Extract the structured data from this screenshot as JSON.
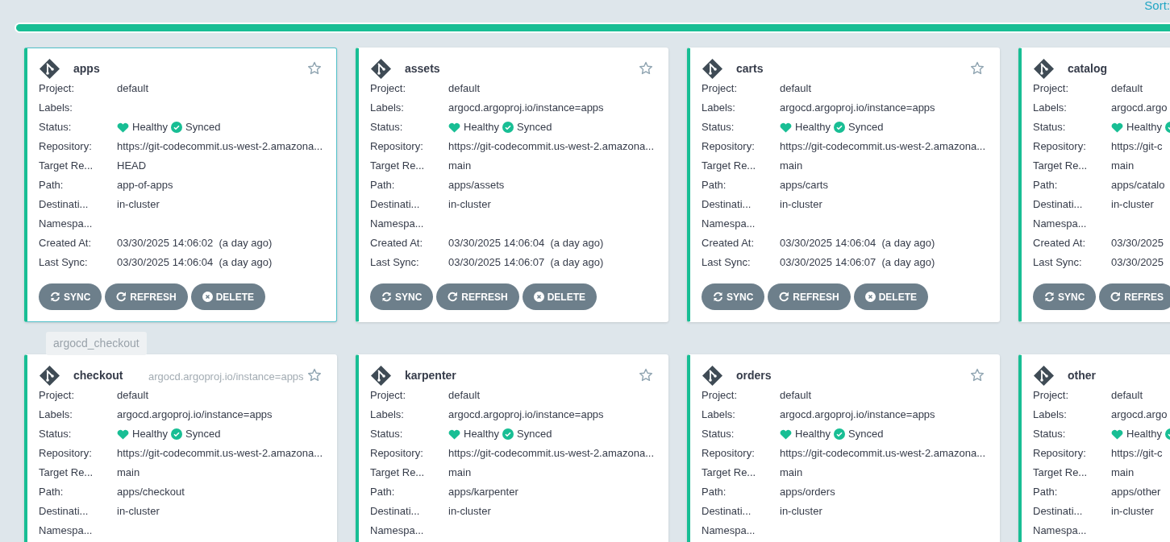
{
  "sort": {
    "label": "Sort:"
  },
  "apps": [
    {
      "name": "apps",
      "selected": true,
      "fields": [
        {
          "kind": "text",
          "label": "Project:",
          "value": "default"
        },
        {
          "kind": "text",
          "label": "Labels:"
        },
        {
          "kind": "status",
          "label": "Status:",
          "healthy": true,
          "health": "Healthy",
          "synced": true,
          "sync": "Synced"
        },
        {
          "kind": "text",
          "label": "Repository:",
          "value": "https://git-codecommit.us-west-2.amazona..."
        },
        {
          "kind": "text",
          "label": "Target Re...",
          "value": "HEAD"
        },
        {
          "kind": "text",
          "label": "Path:",
          "value": "app-of-apps"
        },
        {
          "kind": "text",
          "label": "Destinati...",
          "value": "in-cluster"
        },
        {
          "kind": "text",
          "label": "Namespa..."
        },
        {
          "kind": "text",
          "label": "Created At:",
          "value": "03/30/2025 14:06:02  (a day ago)"
        },
        {
          "kind": "text",
          "label": "Last Sync:",
          "value": "03/30/2025 14:06:04  (a day ago)"
        }
      ],
      "buttons": [
        {
          "kind": "sync",
          "label": "SYNC"
        },
        {
          "kind": "refresh",
          "label": "REFRESH"
        },
        {
          "kind": "delete",
          "label": "DELETE"
        }
      ]
    },
    {
      "name": "assets",
      "selected": false,
      "fields": [
        {
          "kind": "text",
          "label": "Project:",
          "value": "default"
        },
        {
          "kind": "text",
          "label": "Labels:",
          "value": "argocd.argoproj.io/instance=apps"
        },
        {
          "kind": "status",
          "label": "Status:",
          "healthy": true,
          "health": "Healthy",
          "synced": true,
          "sync": "Synced"
        },
        {
          "kind": "text",
          "label": "Repository:",
          "value": "https://git-codecommit.us-west-2.amazona..."
        },
        {
          "kind": "text",
          "label": "Target Re...",
          "value": "main"
        },
        {
          "kind": "text",
          "label": "Path:",
          "value": "apps/assets"
        },
        {
          "kind": "text",
          "label": "Destinati...",
          "value": "in-cluster"
        },
        {
          "kind": "text",
          "label": "Namespa..."
        },
        {
          "kind": "text",
          "label": "Created At:",
          "value": "03/30/2025 14:06:04  (a day ago)"
        },
        {
          "kind": "text",
          "label": "Last Sync:",
          "value": "03/30/2025 14:06:07  (a day ago)"
        }
      ],
      "buttons": [
        {
          "kind": "sync",
          "label": "SYNC"
        },
        {
          "kind": "refresh",
          "label": "REFRESH"
        },
        {
          "kind": "delete",
          "label": "DELETE"
        }
      ]
    },
    {
      "name": "carts",
      "selected": false,
      "fields": [
        {
          "kind": "text",
          "label": "Project:",
          "value": "default"
        },
        {
          "kind": "text",
          "label": "Labels:",
          "value": "argocd.argoproj.io/instance=apps"
        },
        {
          "kind": "status",
          "label": "Status:",
          "healthy": true,
          "health": "Healthy",
          "synced": true,
          "sync": "Synced"
        },
        {
          "kind": "text",
          "label": "Repository:",
          "value": "https://git-codecommit.us-west-2.amazona..."
        },
        {
          "kind": "text",
          "label": "Target Re...",
          "value": "main"
        },
        {
          "kind": "text",
          "label": "Path:",
          "value": "apps/carts"
        },
        {
          "kind": "text",
          "label": "Destinati...",
          "value": "in-cluster"
        },
        {
          "kind": "text",
          "label": "Namespa..."
        },
        {
          "kind": "text",
          "label": "Created At:",
          "value": "03/30/2025 14:06:04  (a day ago)"
        },
        {
          "kind": "text",
          "label": "Last Sync:",
          "value": "03/30/2025 14:06:07  (a day ago)"
        }
      ],
      "buttons": [
        {
          "kind": "sync",
          "label": "SYNC"
        },
        {
          "kind": "refresh",
          "label": "REFRESH"
        },
        {
          "kind": "delete",
          "label": "DELETE"
        }
      ]
    },
    {
      "name": "catalog",
      "selected": false,
      "fields": [
        {
          "kind": "text",
          "label": "Project:",
          "value": "default"
        },
        {
          "kind": "text",
          "label": "Labels:",
          "value": "argocd.argo"
        },
        {
          "kind": "status",
          "label": "Status:",
          "healthy": true,
          "health": "Healthy",
          "synced": true
        },
        {
          "kind": "text",
          "label": "Repository:",
          "value": "https://git-c"
        },
        {
          "kind": "text",
          "label": "Target Re...",
          "value": "main"
        },
        {
          "kind": "text",
          "label": "Path:",
          "value": "apps/catalo"
        },
        {
          "kind": "text",
          "label": "Destinati...",
          "value": "in-cluster"
        },
        {
          "kind": "text",
          "label": "Namespa..."
        },
        {
          "kind": "text",
          "label": "Created At:",
          "value": "03/30/2025"
        },
        {
          "kind": "text",
          "label": "Last Sync:",
          "value": "03/30/2025"
        }
      ],
      "buttons": [
        {
          "kind": "sync",
          "label": "SYNC"
        },
        {
          "kind": "refresh",
          "label": "REFRES"
        }
      ]
    },
    {
      "name": "checkout",
      "selected": false,
      "title_tooltip": "argocd_checkout",
      "labels_tooltip": "argocd.argoproj.io/instance=apps",
      "fields": [
        {
          "kind": "text",
          "label": "Project:",
          "value": "default"
        },
        {
          "kind": "text",
          "label": "Labels:",
          "value": "argocd.argoproj.io/instance=apps"
        },
        {
          "kind": "status",
          "label": "Status:",
          "healthy": true,
          "health": "Healthy",
          "synced": true,
          "sync": "Synced"
        },
        {
          "kind": "text",
          "label": "Repository:",
          "value": "https://git-codecommit.us-west-2.amazona..."
        },
        {
          "kind": "text",
          "label": "Target Re...",
          "value": "main"
        },
        {
          "kind": "text",
          "label": "Path:",
          "value": "apps/checkout"
        },
        {
          "kind": "text",
          "label": "Destinati...",
          "value": "in-cluster"
        },
        {
          "kind": "text",
          "label": "Namespa..."
        }
      ]
    },
    {
      "name": "karpenter",
      "selected": false,
      "fields": [
        {
          "kind": "text",
          "label": "Project:",
          "value": "default"
        },
        {
          "kind": "text",
          "label": "Labels:",
          "value": "argocd.argoproj.io/instance=apps"
        },
        {
          "kind": "status",
          "label": "Status:",
          "healthy": true,
          "health": "Healthy",
          "synced": true,
          "sync": "Synced"
        },
        {
          "kind": "text",
          "label": "Repository:",
          "value": "https://git-codecommit.us-west-2.amazona..."
        },
        {
          "kind": "text",
          "label": "Target Re...",
          "value": "main"
        },
        {
          "kind": "text",
          "label": "Path:",
          "value": "apps/karpenter"
        },
        {
          "kind": "text",
          "label": "Destinati...",
          "value": "in-cluster"
        },
        {
          "kind": "text",
          "label": "Namespa..."
        }
      ]
    },
    {
      "name": "orders",
      "selected": false,
      "fields": [
        {
          "kind": "text",
          "label": "Project:",
          "value": "default"
        },
        {
          "kind": "text",
          "label": "Labels:",
          "value": "argocd.argoproj.io/instance=apps"
        },
        {
          "kind": "status",
          "label": "Status:",
          "healthy": true,
          "health": "Healthy",
          "synced": true,
          "sync": "Synced"
        },
        {
          "kind": "text",
          "label": "Repository:",
          "value": "https://git-codecommit.us-west-2.amazona..."
        },
        {
          "kind": "text",
          "label": "Target Re...",
          "value": "main"
        },
        {
          "kind": "text",
          "label": "Path:",
          "value": "apps/orders"
        },
        {
          "kind": "text",
          "label": "Destinati...",
          "value": "in-cluster"
        },
        {
          "kind": "text",
          "label": "Namespa..."
        }
      ]
    },
    {
      "name": "other",
      "selected": false,
      "fields": [
        {
          "kind": "text",
          "label": "Project:",
          "value": "default"
        },
        {
          "kind": "text",
          "label": "Labels:",
          "value": "argocd.argo"
        },
        {
          "kind": "status",
          "label": "Status:",
          "healthy": true,
          "health": "Healthy",
          "synced": true
        },
        {
          "kind": "text",
          "label": "Repository:",
          "value": "https://git-c"
        },
        {
          "kind": "text",
          "label": "Target Re...",
          "value": "main"
        },
        {
          "kind": "text",
          "label": "Path:",
          "value": "apps/other"
        },
        {
          "kind": "text",
          "label": "Destinati...",
          "value": "in-cluster"
        },
        {
          "kind": "text",
          "label": "Namespa..."
        }
      ]
    }
  ]
}
